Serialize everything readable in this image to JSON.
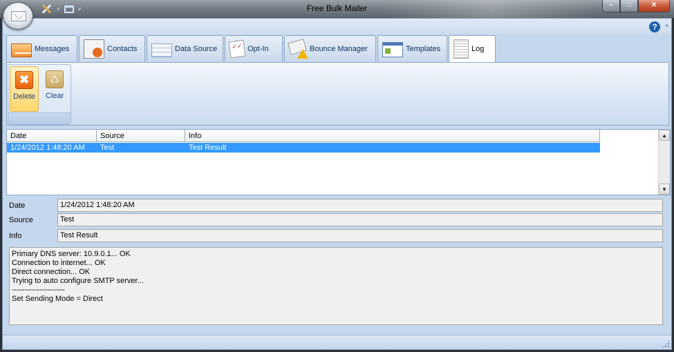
{
  "window": {
    "title": "Free Bulk Mailer",
    "controls": {
      "minimize": "–",
      "maximize": "□",
      "close": "✕"
    }
  },
  "quick_access": {
    "dropdown_glyph": "˅"
  },
  "help": {
    "glyph": "?",
    "dropdown_glyph": "˅"
  },
  "tabs": [
    {
      "label": "Messages",
      "icon": "envelope-icon"
    },
    {
      "label": "Contacts",
      "icon": "contacts-card-icon"
    },
    {
      "label": "Data Source",
      "icon": "table-grid-icon"
    },
    {
      "label": "Opt-In",
      "icon": "checklist-icon"
    },
    {
      "label": "Bounce Manager",
      "icon": "bounce-warning-icon"
    },
    {
      "label": "Templates",
      "icon": "template-icon"
    },
    {
      "label": "Log",
      "icon": "log-document-icon",
      "active": true
    }
  ],
  "ribbon": {
    "delete_label": "Delete",
    "delete_glyph": "✖",
    "clear_label": "Clear",
    "clear_glyph": "♺"
  },
  "log_list": {
    "columns": [
      "Date",
      "Source",
      "Info"
    ],
    "rows": [
      {
        "date": "1/24/2012 1:48:20 AM",
        "source": "Test",
        "info": "Test Result",
        "selected": true
      }
    ],
    "scroll_up": "▲",
    "scroll_down": "▼"
  },
  "details": {
    "date_label": "Date",
    "date_value": "1/24/2012 1:48:20 AM",
    "source_label": "Source",
    "source_value": "Test",
    "info_label": "Info",
    "info_value": "Test Result",
    "log_lines": [
      "Primary DNS server: 10.9.0.1... OK",
      "Connection to internet... OK",
      "Direct connection... OK",
      "Trying to auto configure SMTP server...",
      "---------------------",
      "Set Sending Mode = Direct"
    ]
  },
  "colors": {
    "selection": "#3399ff",
    "frame": "#c5d7ec",
    "accent_orange": "#e8620c"
  }
}
